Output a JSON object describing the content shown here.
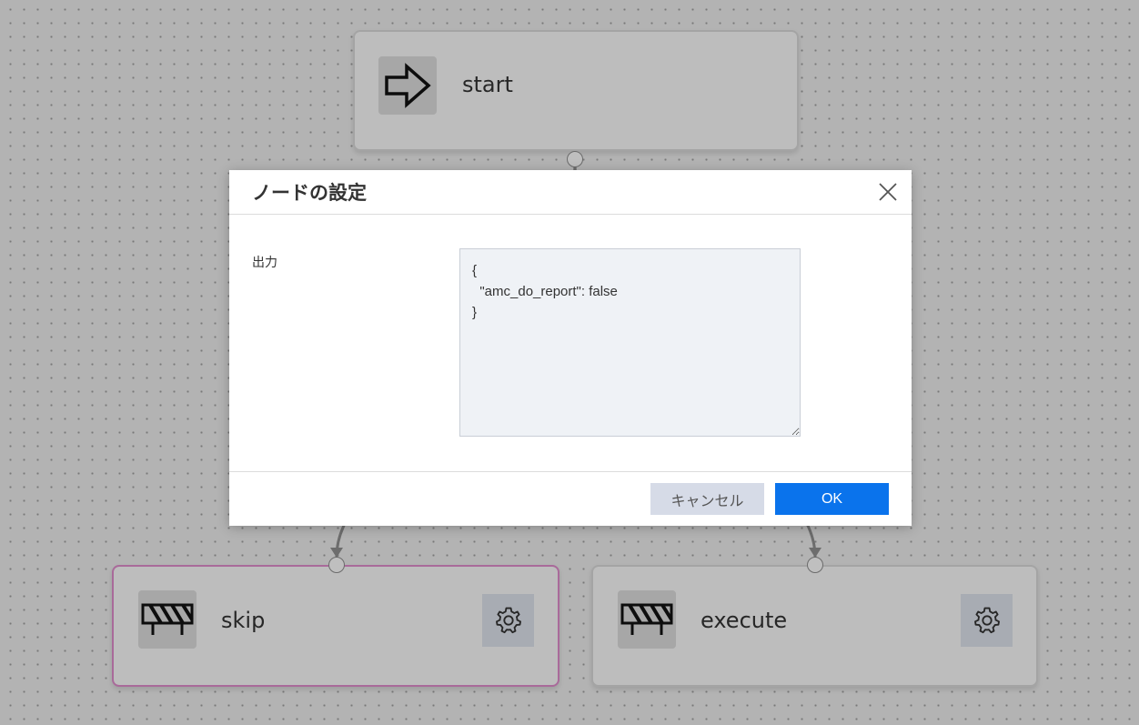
{
  "flow": {
    "nodes": [
      {
        "label": "start",
        "icon": "arrow-right-icon"
      },
      {
        "label": "skip",
        "icon": "barrier-icon"
      },
      {
        "label": "execute",
        "icon": "barrier-icon"
      }
    ]
  },
  "modal": {
    "title": "ノードの設定",
    "output_label": "出力",
    "output_value": "{\n  \"amc_do_report\": false\n}",
    "cancel_label": "キャンセル",
    "ok_label": "OK"
  },
  "colors": {
    "primary": "#0a73ec",
    "secondary_button": "#d6dbe7",
    "selected_border": "#d988c6",
    "textarea_bg": "#eff2f6"
  }
}
